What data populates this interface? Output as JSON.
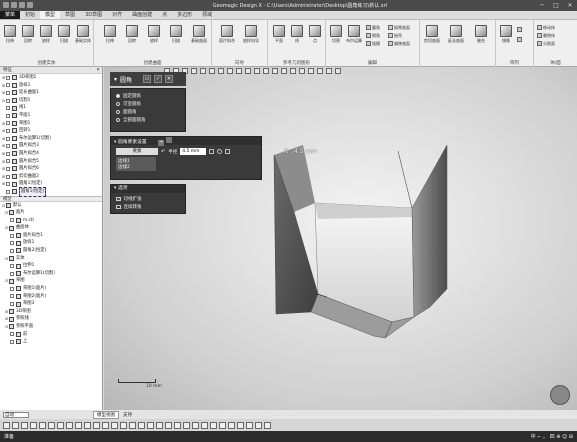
{
  "titlebar": {
    "title": "Geomagic Design X - C:\\Users\\Administrator\\Desktop\\圆角练习\\新认.xrl"
  },
  "menu": {
    "items": [
      "菜单",
      "初始",
      "模型",
      "草图",
      "3D草图",
      "对齐",
      "曲面创建",
      "点",
      "多边形",
      "领域"
    ],
    "file": "菜单",
    "active": "模型"
  },
  "ribbon": {
    "groups": [
      {
        "caption": "创建实体",
        "buttons": [
          "拉伸",
          "回转",
          "放样",
          "扫描",
          "基础实体"
        ]
      },
      {
        "caption": "创建曲面",
        "buttons": [
          "拉伸",
          "回转",
          "放样",
          "扫描",
          "基础曲面"
        ]
      },
      {
        "caption": "向导",
        "buttons": [
          "面片拟合",
          "放样向导"
        ]
      },
      {
        "caption": "参考几何图形",
        "buttons": [
          "平面",
          "线",
          "点"
        ]
      },
      {
        "caption": "编辑",
        "buttons": [
          "切割",
          "布尔运算"
        ],
        "small": [
          "圆角",
          "倒角",
          "拔模",
          "赋厚曲面",
          "抽壳",
          "偏移曲面"
        ]
      },
      {
        "caption": "",
        "buttons": [
          "剪切曲面",
          "延长曲面",
          "缝合"
        ]
      },
      {
        "caption": "阵列",
        "buttons": [
          "镜像"
        ],
        "small": [
          "线形阵列",
          "圆形阵列"
        ]
      },
      {
        "caption": "体/面",
        "small": [
          "移动体",
          "删除体",
          "分割面"
        ]
      }
    ]
  },
  "panel": {
    "feature_header": "特征",
    "features": [
      "3D草图1",
      "放样1",
      "延长曲面1",
      "切割1",
      "线1",
      "平面1",
      "草图1",
      "回转1",
      "布尔运算1(切割)",
      "圆片拟合3",
      "圆片拟合4",
      "圆片拟合5",
      "圆片拟合6",
      "剪切曲面2",
      "圆角1(恒定)",
      "圆角1(恒定)"
    ],
    "model_header": "模型",
    "model_root": "默认",
    "model": [
      "面片",
      "m.stl",
      "曲面体",
      "面片拟合1",
      "放样1",
      "圆角2(恒定)",
      "实体",
      "拉伸1",
      "布尔运算1(切割)",
      "草图",
      "草图1(面片)",
      "草图2(面片)",
      "草图3",
      "3D草图",
      "参照线",
      "参照平面",
      "前",
      "上"
    ]
  },
  "dialog": {
    "title": "圆角",
    "types": [
      "固定圆角",
      "可变圆角",
      "面圆角",
      "全部面圆角"
    ],
    "selected_type": "固定圆角",
    "section_title": "圆角要素设置",
    "ele_label": "要素",
    "radius_label": "半径",
    "radius_value": "4.5 mm",
    "edge_items": [
      "边线1",
      "边线2"
    ],
    "options_title": "选项",
    "options": [
      {
        "label": "切线扩张",
        "checked": true
      },
      {
        "label": "连续转角",
        "checked": false
      }
    ]
  },
  "viewport": {
    "annotation": "R : 4.5 mm",
    "scale_label": "10 mm"
  },
  "statusbar": {
    "mode": "自动",
    "tabs": [
      "模型视图",
      "支持"
    ]
  },
  "taskbar": {
    "left": "准备",
    "right": "中 ⌐ 。 四 ⊕ ☺ ⊞"
  },
  "colors": {
    "dialog_bg": "#3a3a3a",
    "title_bg": "#4a4a4a",
    "view_center": "#f4f4f4",
    "shape_dark": "#5a5a5a"
  }
}
